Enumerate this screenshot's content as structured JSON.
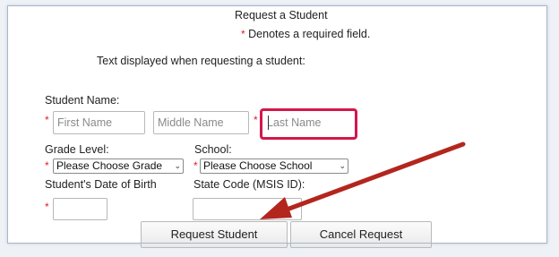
{
  "form": {
    "title": "Request a Student",
    "required_marker": "*",
    "required_note": "Denotes a required field.",
    "display_text_label": "Text displayed when requesting a student:",
    "student_name_label": "Student Name:",
    "first_name_placeholder": "First Name",
    "middle_name_placeholder": "Middle Name",
    "last_name_placeholder": "Last Name",
    "grade_level_label": "Grade Level:",
    "grade_level_value": "Please Choose Grade",
    "school_label": "School:",
    "school_value": "Please Choose School",
    "dob_label": "Student's Date of Birth",
    "state_code_label": "State Code (MSIS ID):",
    "request_button": "Request Student",
    "cancel_button": "Cancel Request"
  },
  "colors": {
    "highlight": "#d3174b",
    "arrow": "#b3261e",
    "required": "#e0202a"
  },
  "annotation": {
    "arrow_icon": "red-arrow",
    "highlight_target": "last-name-field"
  }
}
